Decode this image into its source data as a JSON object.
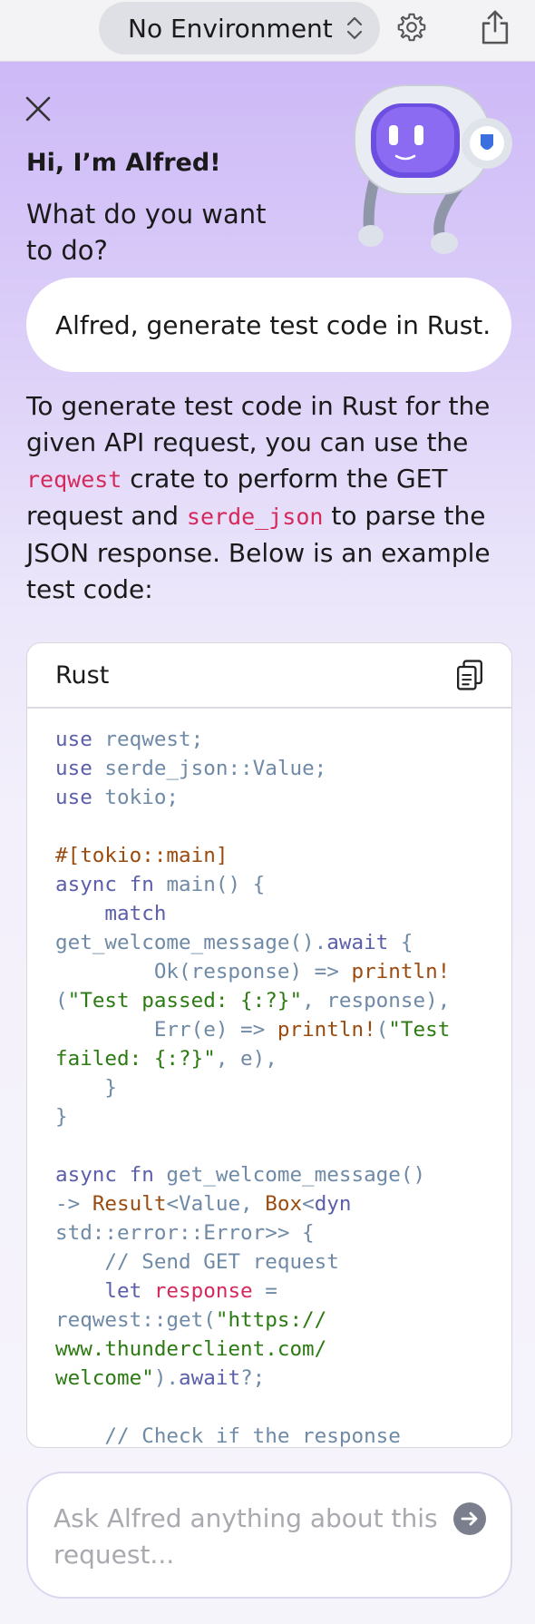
{
  "topbar": {
    "environment_label": "No Environment",
    "icons": [
      "chevron-updown-icon",
      "gear-icon",
      "share-icon"
    ]
  },
  "alfred": {
    "greeting": "Hi, I’m Alfred!",
    "prompt": "What do you want to do?"
  },
  "chat": {
    "user_message": "Alfred, generate test code in Rust.",
    "answer_parts": [
      "To generate test code in Rust for the given API request, you can use the ",
      "reqwest",
      " crate to perform the GET request and ",
      "serde_json",
      " to parse the JSON response. Below is an example test code:"
    ]
  },
  "code_block": {
    "language": "Rust",
    "lines": [
      "use reqwest;",
      "use serde_json::Value;",
      "use tokio;",
      "",
      "#[tokio::main]",
      "async fn main() {",
      "    match",
      "get_welcome_message().await {",
      "        Ok(response) => println!",
      "(\"Test passed: {:?}\", response),",
      "        Err(e) => println!(\"Test",
      "failed: {:?}\", e),",
      "    }",
      "}",
      "",
      "async fn get_welcome_message()",
      "-> Result<Value, Box<dyn",
      "std::error::Error>> {",
      "    // Send GET request",
      "    let response =",
      "reqwest::get(\"https://",
      "www.thunderclient.com/",
      "welcome\").await?;",
      "",
      "    // Check if the response"
    ]
  },
  "input": {
    "placeholder": "Ask Alfred anything about this request..."
  },
  "colors": {
    "accent": "#cdb9f7",
    "inline_code": "#d6295b",
    "keyword": "#5b5fa9",
    "string": "#2c7a12"
  }
}
